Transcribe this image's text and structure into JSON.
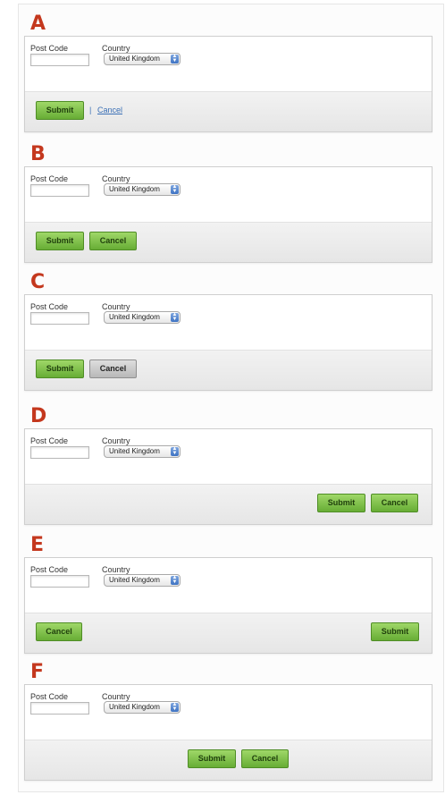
{
  "labels": {
    "post_code": "Post Code",
    "country": "Country",
    "country_value": "United Kingdom",
    "submit": "Submit",
    "cancel": "Cancel",
    "separator": "|"
  },
  "variants": [
    {
      "letter": "A",
      "button_style": "primary button with text link",
      "cancel_style": "link"
    },
    {
      "letter": "B",
      "button_style": "two equal primary buttons"
    },
    {
      "letter": "C",
      "button_style": "primary and secondary grey button"
    },
    {
      "letter": "D",
      "button_style": "buttons aligned right"
    },
    {
      "letter": "E",
      "button_style": "cancel left, submit right"
    },
    {
      "letter": "F",
      "button_style": "buttons centered"
    }
  ],
  "colors": {
    "letter": "#c4381e",
    "primary_button": "#7bbf45",
    "secondary_button": "#c8c8c8",
    "link": "#3a6fb5",
    "button_bar": "#ececec"
  },
  "icons": {
    "select_arrows": "up-down-arrows-icon"
  }
}
